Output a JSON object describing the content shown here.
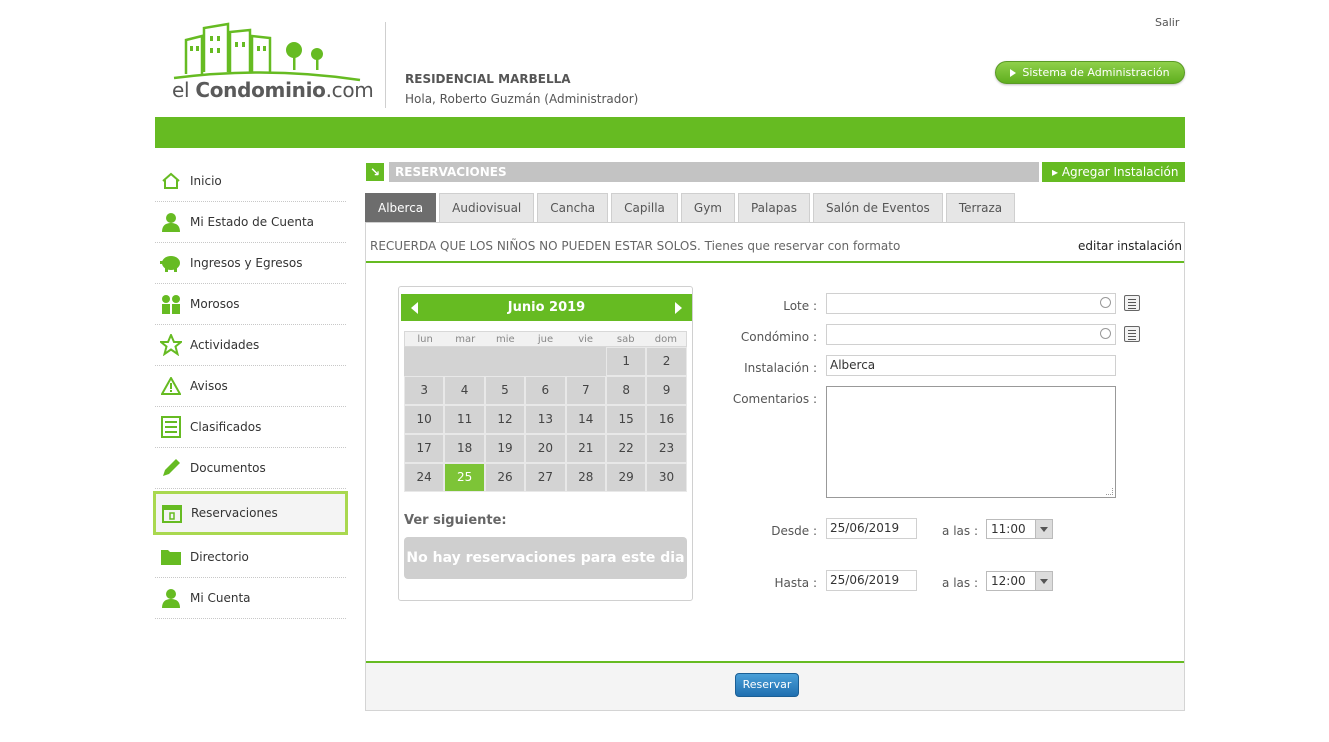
{
  "header": {
    "logo_prefix": "el ",
    "logo_bold": "Condominio",
    "logo_suffix": ".com",
    "complex_name": "RESIDENCIAL MARBELLA",
    "greeting": "Hola, Roberto Guzmán (Administrador)",
    "logout": "Salir",
    "admin_button": "Sistema de Administración"
  },
  "sidebar": {
    "items": [
      {
        "label": "Inicio",
        "icon": "home-icon"
      },
      {
        "label": "Mi Estado de Cuenta",
        "icon": "user-icon"
      },
      {
        "label": "Ingresos y Egresos",
        "icon": "piggy-bank-icon"
      },
      {
        "label": "Morosos",
        "icon": "users-icon"
      },
      {
        "label": "Actividades",
        "icon": "star-icon"
      },
      {
        "label": "Avisos",
        "icon": "warning-icon"
      },
      {
        "label": "Clasificados",
        "icon": "list-icon"
      },
      {
        "label": "Documentos",
        "icon": "pencil-icon"
      },
      {
        "label": "Reservaciones",
        "icon": "calendar-icon",
        "active": true
      },
      {
        "label": "Directorio",
        "icon": "folder-icon"
      },
      {
        "label": "Mi Cuenta",
        "icon": "user-icon"
      }
    ]
  },
  "section": {
    "title": "RESERVACIONES",
    "add_button": "Agregar Instalación"
  },
  "tabs": [
    "Alberca",
    "Audiovisual",
    "Cancha",
    "Capilla",
    "Gym",
    "Palapas",
    "Salón de Eventos",
    "Terraza"
  ],
  "active_tab": "Alberca",
  "notice": "RECUERDA QUE LOS NIÑOS NO PUEDEN ESTAR SOLOS. Tienes que reservar con formato",
  "edit_link": "editar instalación",
  "calendar": {
    "title": "Junio 2019",
    "days_of_week": [
      "lun",
      "mar",
      "mie",
      "jue",
      "vie",
      "sab",
      "dom"
    ],
    "weeks": [
      [
        "",
        "",
        "",
        "",
        "",
        "1",
        "2"
      ],
      [
        "3",
        "4",
        "5",
        "6",
        "7",
        "8",
        "9"
      ],
      [
        "10",
        "11",
        "12",
        "13",
        "14",
        "15",
        "16"
      ],
      [
        "17",
        "18",
        "19",
        "20",
        "21",
        "22",
        "23"
      ],
      [
        "24",
        "25",
        "26",
        "27",
        "28",
        "29",
        "30"
      ]
    ],
    "selected_day": "25",
    "next_label": "Ver siguiente:",
    "no_reservations": "No hay reservaciones para este dia"
  },
  "form": {
    "lote_label": "Lote :",
    "lote_value": "",
    "condomino_label": "Condómino :",
    "condomino_value": "",
    "instalacion_label": "Instalación :",
    "instalacion_value": "Alberca",
    "comentarios_label": "Comentarios :",
    "comentarios_value": "",
    "desde_label": "Desde :",
    "desde_date": "25/06/2019",
    "desde_at_label": "a las :",
    "desde_time": "11:00",
    "hasta_label": "Hasta :",
    "hasta_date": "25/06/2019",
    "hasta_at_label": "a las :",
    "hasta_time": "12:00"
  },
  "submit_button": "Reservar",
  "colors": {
    "brand_green": "#66bb22",
    "button_blue": "#1f6fb0",
    "section_gray": "#c3c3c3"
  }
}
